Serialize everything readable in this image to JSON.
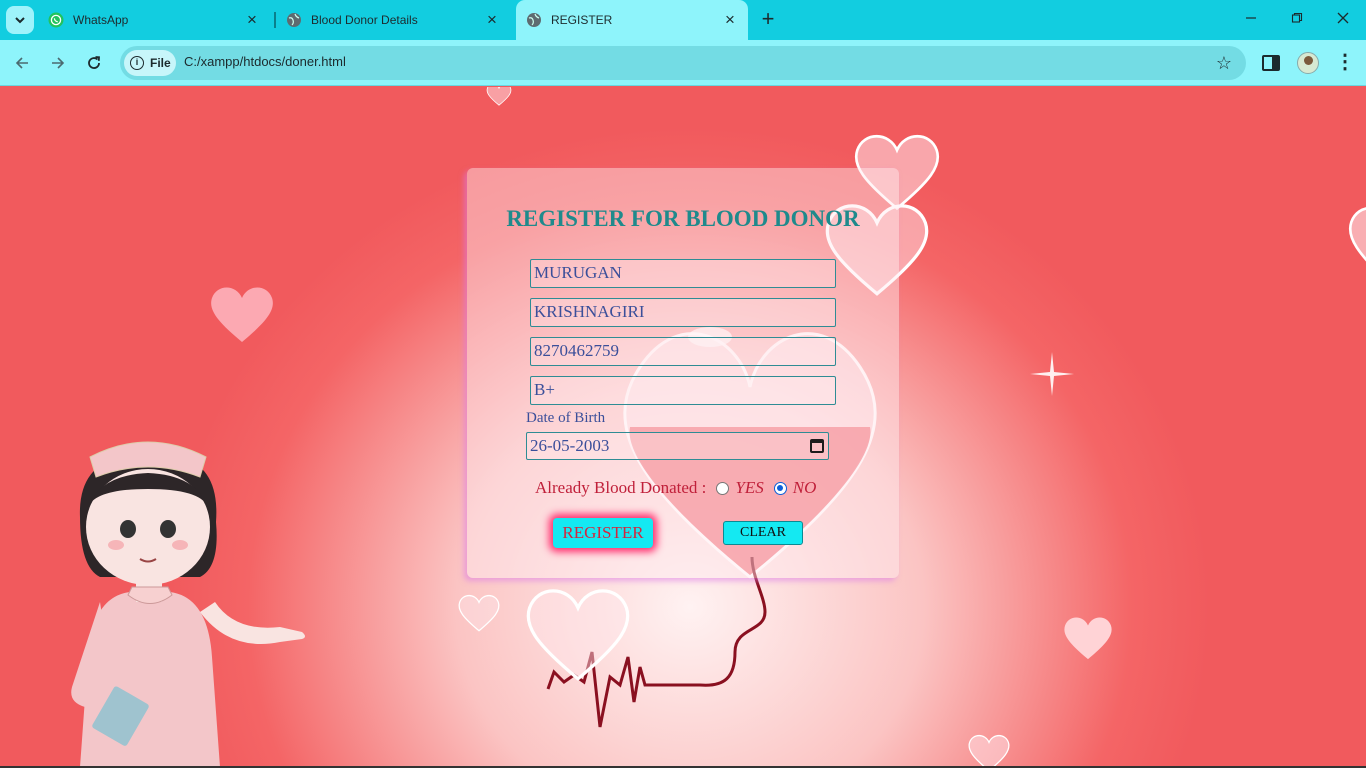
{
  "browser": {
    "tabs": [
      {
        "title": "WhatsApp",
        "icon": "whatsapp-icon",
        "active": false
      },
      {
        "title": "Blood Donor Details",
        "icon": "globe-icon",
        "active": false
      },
      {
        "title": "REGISTER",
        "icon": "globe-icon",
        "active": true
      }
    ],
    "chip_label": "File",
    "url": "C:/xampp/htdocs/doner.html"
  },
  "form": {
    "title": "REGISTER FOR BLOOD DONOR",
    "name_value": "MURUGAN",
    "place_value": "KRISHNAGIRI",
    "phone_value": "8270462759",
    "blood_group_value": "B+",
    "dob_label": "Date of Birth",
    "dob_value": "26-05-2003",
    "donated_label": "Already Blood Donated :",
    "option_yes": "YES",
    "option_no": "NO",
    "selected_option": "NO",
    "register_label": "REGISTER",
    "clear_label": "CLEAR"
  },
  "colors": {
    "tabbar": "#12cde0",
    "toolbar": "#8ef4fb",
    "page_bg": "#f35a5e",
    "title": "#1f8a8c",
    "button": "#14e9f2"
  }
}
